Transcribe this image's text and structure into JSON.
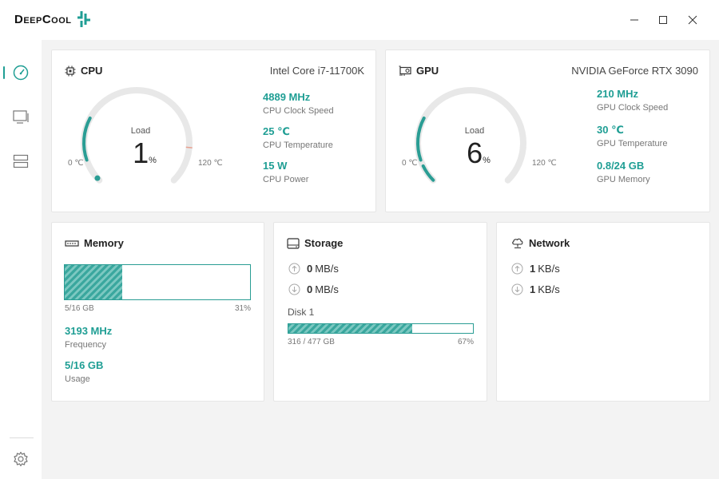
{
  "app": {
    "logo": "DeepCool"
  },
  "window": {
    "minimize": "minimize",
    "maximize": "maximize",
    "close": "close"
  },
  "accent": "#1f9e94",
  "sidebar": {
    "items": [
      "dashboard-icon",
      "monitor-icon",
      "storage-icon"
    ],
    "settings": "settings-icon"
  },
  "cpu": {
    "title": "CPU",
    "model": "Intel Core i7-11700K",
    "load_label": "Load",
    "load": "1",
    "load_unit": "%",
    "load_fraction": 0.01,
    "min": "0 ℃",
    "max": "120 ℃",
    "metrics": [
      {
        "value": "4889 MHz",
        "label": "CPU Clock Speed"
      },
      {
        "value": "25 ℃",
        "label": "CPU Temperature"
      },
      {
        "value": "15 W",
        "label": "CPU Power"
      }
    ]
  },
  "gpu": {
    "title": "GPU",
    "model": "NVIDIA GeForce RTX 3090",
    "load_label": "Load",
    "load": "6",
    "load_unit": "%",
    "load_fraction": 0.06,
    "min": "0 ℃",
    "max": "120 ℃",
    "metrics": [
      {
        "value": "210 MHz",
        "label": "GPU Clock Speed"
      },
      {
        "value": "30 ℃",
        "label": "GPU Temperature"
      },
      {
        "value": "0.8/24 GB",
        "label": "GPU Memory"
      }
    ]
  },
  "memory": {
    "title": "Memory",
    "used": "5/16 GB",
    "percent": "31%",
    "fraction": 0.31,
    "metrics": [
      {
        "value": "3193 MHz",
        "label": "Frequency"
      },
      {
        "value": "5/16 GB",
        "label": "Usage"
      }
    ]
  },
  "storage": {
    "title": "Storage",
    "upload": "0",
    "download": "0",
    "unit": "MB/s",
    "disk_label": "Disk 1",
    "disk_used": "316 / 477 GB",
    "disk_percent": "67%",
    "disk_fraction": 0.67
  },
  "network": {
    "title": "Network",
    "upload": "1",
    "download": "1",
    "unit": "KB/s"
  }
}
